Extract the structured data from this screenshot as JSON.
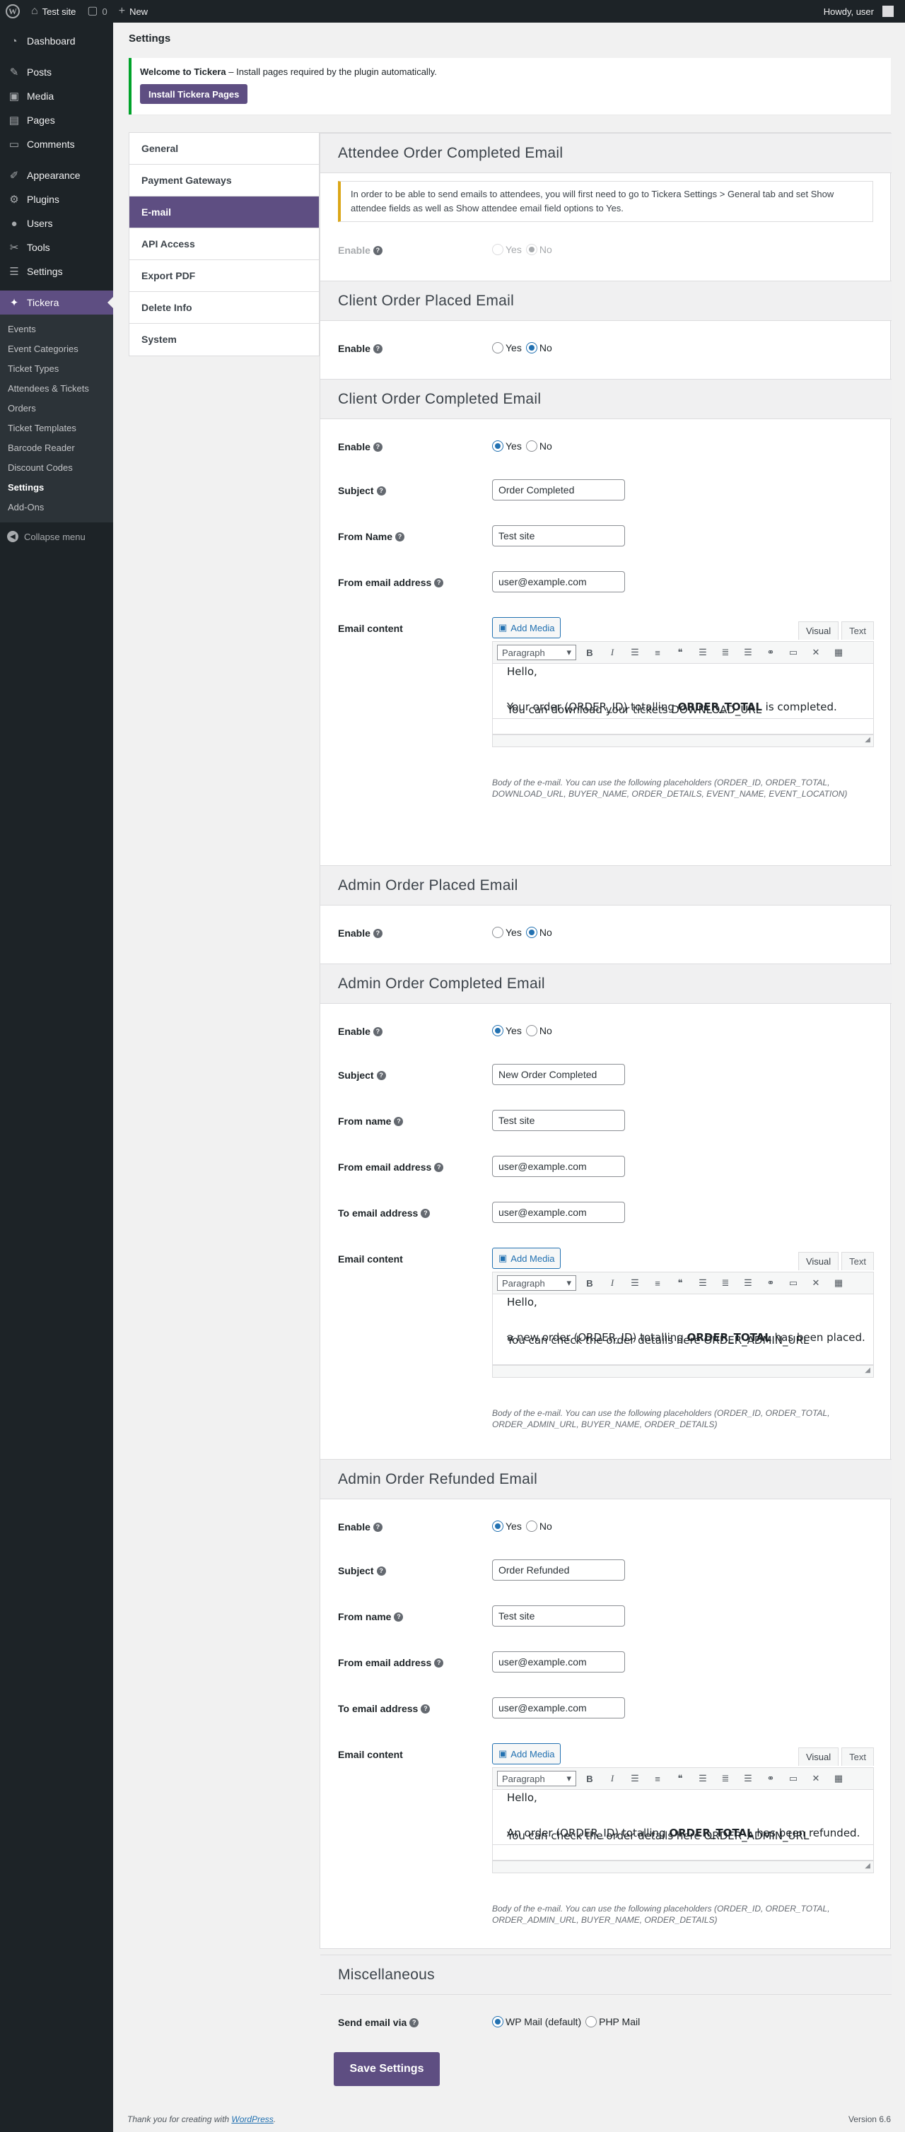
{
  "adminbar": {
    "site_name": "Test site",
    "comments_count": "0",
    "new_label": "New",
    "greeting": "Howdy, user"
  },
  "sidebar": {
    "items": [
      {
        "label": "Dashboard",
        "icon": "dashboard-icon"
      },
      {
        "label": "Posts",
        "icon": "pin-icon"
      },
      {
        "label": "Media",
        "icon": "media-icon"
      },
      {
        "label": "Pages",
        "icon": "pages-icon"
      },
      {
        "label": "Comments",
        "icon": "comment-icon"
      },
      {
        "label": "Appearance",
        "icon": "brush-icon"
      },
      {
        "label": "Plugins",
        "icon": "plug-icon"
      },
      {
        "label": "Users",
        "icon": "user-icon"
      },
      {
        "label": "Tools",
        "icon": "wrench-icon"
      },
      {
        "label": "Settings",
        "icon": "sliders-icon"
      },
      {
        "label": "Tickera",
        "icon": "ticket-icon"
      }
    ],
    "submenu": [
      "Events",
      "Event Categories",
      "Ticket Types",
      "Attendees & Tickets",
      "Orders",
      "Ticket Templates",
      "Barcode Reader",
      "Discount Codes",
      "Settings",
      "Add-Ons"
    ],
    "collapse": "Collapse menu"
  },
  "page": {
    "title": "Settings"
  },
  "notice": {
    "bold": "Welcome to Tickera",
    "text": " – Install pages required by the plugin automatically.",
    "button": "Install Tickera Pages"
  },
  "tabs": [
    "General",
    "Payment Gateways",
    "E-mail",
    "API Access",
    "Export PDF",
    "Delete Info",
    "System"
  ],
  "radio": {
    "yes": "Yes",
    "no": "No"
  },
  "sections": {
    "attendee_completed": {
      "title": "Attendee Order Completed Email",
      "warning": "In order to be able to send emails to attendees, you will first need to go to Tickera Settings > General tab and set Show attendee fields as well as Show attendee email field options to Yes.",
      "enable": "Enable"
    },
    "client_placed": {
      "title": "Client Order Placed Email",
      "enable": "Enable"
    },
    "client_completed": {
      "title": "Client Order Completed Email",
      "enable": "Enable",
      "subject_label": "Subject",
      "subject": "Order Completed",
      "from_name_label": "From Name",
      "from_name": "Test site",
      "from_email_label": "From email address",
      "from_email": "user@example.com",
      "content_label": "Email content",
      "line1": "Hello,",
      "line2a": "Your order (ORDER_ID) totalling ",
      "line2b": "ORDER_TOTAL",
      "line2c": " is completed.",
      "line3": "You can download your tickets DOWNLOAD_URL",
      "desc": "Body of the e-mail. You can use the following placeholders (ORDER_ID, ORDER_TOTAL, DOWNLOAD_URL, BUYER_NAME, ORDER_DETAILS, EVENT_NAME, EVENT_LOCATION)"
    },
    "admin_placed": {
      "title": "Admin Order Placed Email",
      "enable": "Enable"
    },
    "admin_completed": {
      "title": "Admin Order Completed Email",
      "enable": "Enable",
      "subject_label": "Subject",
      "subject": "New Order Completed",
      "from_name_label": "From name",
      "from_name": "Test site",
      "from_email_label": "From email address",
      "from_email": "user@example.com",
      "to_email_label": "To email address",
      "to_email": "user@example.com",
      "content_label": "Email content",
      "line1": "Hello,",
      "line2a": "a new order (ORDER_ID) totalling ",
      "line2b": "ORDER_TOTAL",
      "line2c": " has been placed.",
      "line3": "You can check the order details here ORDER_ADMIN_URL",
      "desc": "Body of the e-mail. You can use the following placeholders (ORDER_ID, ORDER_TOTAL, ORDER_ADMIN_URL, BUYER_NAME, ORDER_DETAILS)"
    },
    "admin_refunded": {
      "title": "Admin Order Refunded Email",
      "enable": "Enable",
      "subject_label": "Subject",
      "subject": "Order Refunded",
      "from_name_label": "From name",
      "from_name": "Test site",
      "from_email_label": "From email address",
      "from_email": "user@example.com",
      "to_email_label": "To email address",
      "to_email": "user@example.com",
      "content_label": "Email content",
      "line1": "Hello,",
      "line2a": "An order (ORDER_ID) totalling ",
      "line2b": "ORDER_TOTAL",
      "line2c": " has been refunded.",
      "line3": "You can check the order details here ORDER_ADMIN_URL",
      "desc": "Body of the e-mail. You can use the following placeholders (ORDER_ID, ORDER_TOTAL, ORDER_ADMIN_URL, BUYER_NAME, ORDER_DETAILS)"
    },
    "misc": {
      "title": "Miscellaneous",
      "send_label": "Send email via",
      "opt1": "WP Mail (default)",
      "opt2": "PHP Mail"
    }
  },
  "editor": {
    "add_media": "Add Media",
    "visual": "Visual",
    "text": "Text",
    "format": "Paragraph"
  },
  "save_button": "Save Settings",
  "footer": {
    "text": "Thank you for creating with ",
    "link": "WordPress",
    "end": ".",
    "version": "Version 6.6"
  },
  "colors": {
    "accent": "#5e4e82",
    "adminbar": "#1d2327",
    "link": "#2271b1"
  }
}
